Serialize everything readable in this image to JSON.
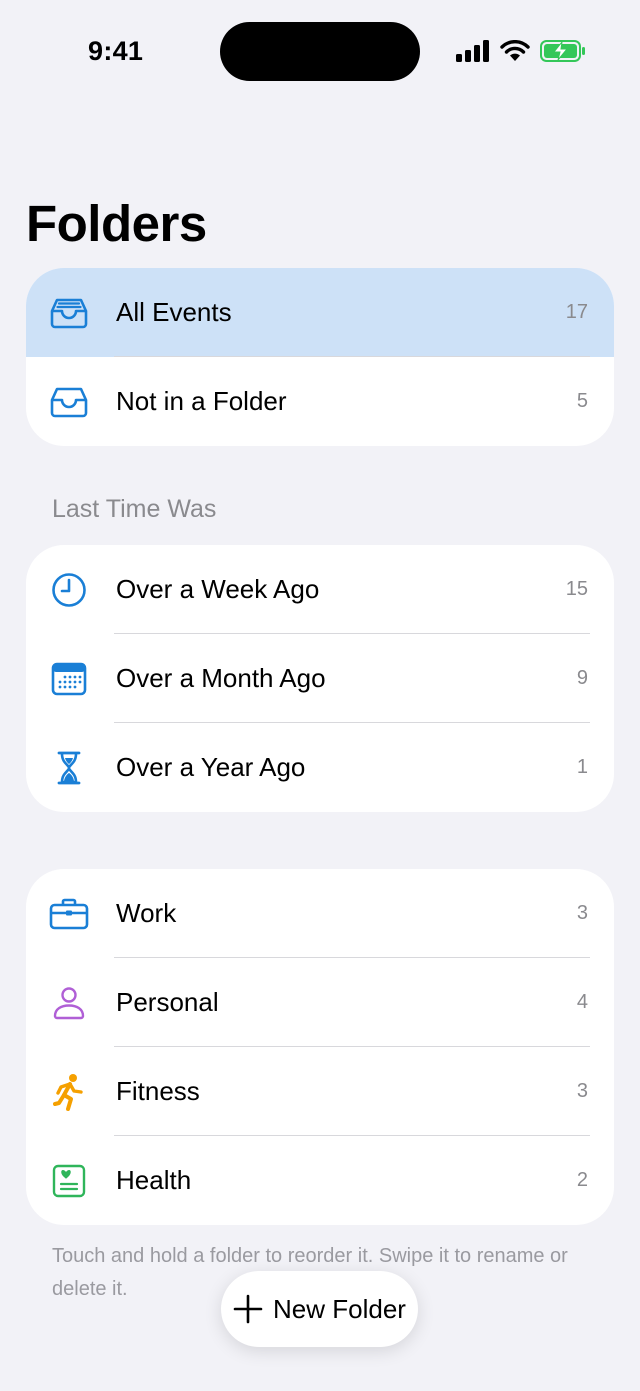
{
  "status_bar": {
    "time": "9:41",
    "battery_color": "#34c759"
  },
  "header": {
    "title": "Folders"
  },
  "top_group": [
    {
      "icon": "tray-full-icon",
      "label": "All Events",
      "count": "17",
      "selected": true
    },
    {
      "icon": "tray-icon",
      "label": "Not in a Folder",
      "count": "5",
      "selected": false
    }
  ],
  "last_time_section": {
    "header": "Last Time Was",
    "items": [
      {
        "icon": "clock-icon",
        "label": "Over a Week Ago",
        "count": "15"
      },
      {
        "icon": "calendar-icon",
        "label": "Over a Month Ago",
        "count": "9"
      },
      {
        "icon": "hourglass-icon",
        "label": "Over a Year Ago",
        "count": "1"
      }
    ]
  },
  "folders": [
    {
      "icon": "briefcase-icon",
      "label": "Work",
      "count": "3",
      "color": "#1a7fd6"
    },
    {
      "icon": "person-icon",
      "label": "Personal",
      "count": "4",
      "color": "#b05fd6"
    },
    {
      "icon": "running-figure-icon",
      "label": "Fitness",
      "count": "3",
      "color": "#f5a000"
    },
    {
      "icon": "health-record-icon",
      "label": "Health",
      "count": "2",
      "color": "#2fb55a"
    }
  ],
  "footer": {
    "note": "Touch and hold a folder to reorder it. Swipe it to rename or delete it."
  },
  "new_folder_button": {
    "label": "New Folder"
  },
  "colors": {
    "accent": "#1a7fd6",
    "selected_row": "#cde1f7",
    "background": "#f2f2f7"
  }
}
